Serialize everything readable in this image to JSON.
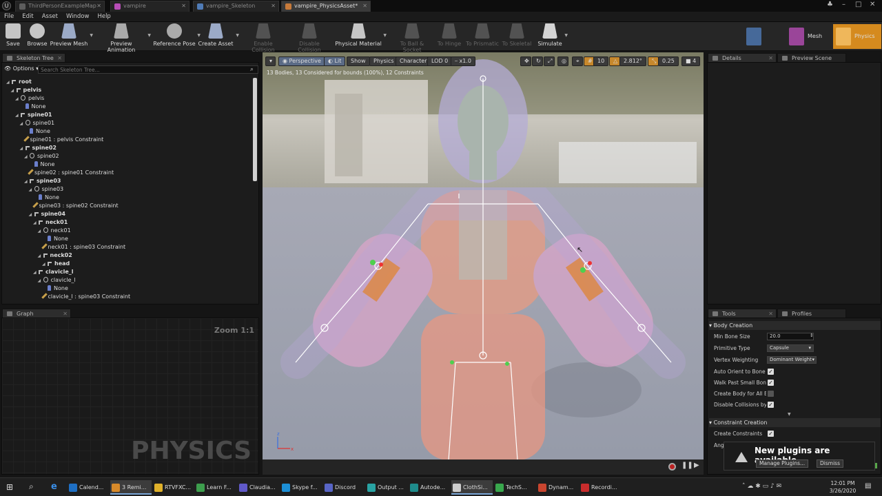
{
  "tabs": [
    {
      "label": "ThirdPersonExampleMap",
      "active": false,
      "color": "#5d5d5d"
    },
    {
      "label": "vampire",
      "active": false,
      "color": "#b84db7"
    },
    {
      "label": "vampire_Skeleton",
      "active": false,
      "color": "#4f7bb6"
    },
    {
      "label": "vampire_PhysicsAsset*",
      "active": true,
      "color": "#c77a3a"
    }
  ],
  "menu": [
    "File",
    "Edit",
    "Asset",
    "Window",
    "Help"
  ],
  "toolbar": [
    {
      "label": "Save",
      "icon": "save-icon",
      "enabled": true
    },
    {
      "label": "Browse",
      "icon": "browse-icon",
      "enabled": true
    },
    {
      "label": "Preview Mesh",
      "icon": "preview-mesh-icon",
      "enabled": true
    },
    {
      "label": "Preview Animation",
      "icon": "preview-animation-icon",
      "enabled": true
    },
    {
      "label": "Reference Pose",
      "icon": "reference-pose-icon",
      "enabled": true
    },
    {
      "label": "Create Asset",
      "icon": "create-asset-icon",
      "enabled": true
    },
    {
      "label": "Enable Collision",
      "icon": "enable-collision-icon",
      "enabled": false
    },
    {
      "label": "Disable Collision",
      "icon": "disable-collision-icon",
      "enabled": false
    },
    {
      "label": "Physical Material",
      "icon": "physical-material-icon",
      "enabled": true
    },
    {
      "label": "To Ball & Socket",
      "icon": "ball-socket-icon",
      "enabled": false
    },
    {
      "label": "To Hinge",
      "icon": "hinge-icon",
      "enabled": false
    },
    {
      "label": "To Prismatic",
      "icon": "prismatic-icon",
      "enabled": false
    },
    {
      "label": "To Skeletal",
      "icon": "skeletal-icon",
      "enabled": false
    },
    {
      "label": "Simulate",
      "icon": "simulate-icon",
      "enabled": true
    }
  ],
  "modes": [
    {
      "label": "Skeleton",
      "active": false
    },
    {
      "label": "Mesh",
      "active": false
    },
    {
      "label": "Physics",
      "active": true
    }
  ],
  "skeleton_tree": {
    "tab": "Skeleton Tree",
    "options": "Options",
    "search_placeholder": "Search Skeleton Tree...",
    "rows": [
      {
        "text": "root",
        "kind": "bone",
        "depth": 0,
        "bold": true
      },
      {
        "text": "pelvis",
        "kind": "bone",
        "depth": 1,
        "bold": true
      },
      {
        "text": "pelvis",
        "kind": "body",
        "depth": 2,
        "bold": false
      },
      {
        "text": "None",
        "kind": "shape",
        "depth": 3,
        "bold": false
      },
      {
        "text": "spine01",
        "kind": "bone",
        "depth": 2,
        "bold": true
      },
      {
        "text": "spine01",
        "kind": "body",
        "depth": 3,
        "bold": false
      },
      {
        "text": "None",
        "kind": "shape",
        "depth": 4,
        "bold": false
      },
      {
        "text": "spine01 : pelvis Constraint",
        "kind": "constr",
        "depth": 3,
        "bold": false
      },
      {
        "text": "spine02",
        "kind": "bone",
        "depth": 3,
        "bold": true
      },
      {
        "text": "spine02",
        "kind": "body",
        "depth": 4,
        "bold": false
      },
      {
        "text": "None",
        "kind": "shape",
        "depth": 5,
        "bold": false
      },
      {
        "text": "spine02 : spine01 Constraint",
        "kind": "constr",
        "depth": 4,
        "bold": false
      },
      {
        "text": "spine03",
        "kind": "bone",
        "depth": 4,
        "bold": true
      },
      {
        "text": "spine03",
        "kind": "body",
        "depth": 5,
        "bold": false
      },
      {
        "text": "None",
        "kind": "shape",
        "depth": 6,
        "bold": false
      },
      {
        "text": "spine03 : spine02 Constraint",
        "kind": "constr",
        "depth": 5,
        "bold": false
      },
      {
        "text": "spine04",
        "kind": "bone",
        "depth": 5,
        "bold": true
      },
      {
        "text": "neck01",
        "kind": "bone",
        "depth": 6,
        "bold": true
      },
      {
        "text": "neck01",
        "kind": "body",
        "depth": 7,
        "bold": false
      },
      {
        "text": "None",
        "kind": "shape",
        "depth": 8,
        "bold": false
      },
      {
        "text": "neck01 : spine03 Constraint",
        "kind": "constr",
        "depth": 7,
        "bold": false
      },
      {
        "text": "neck02",
        "kind": "bone",
        "depth": 7,
        "bold": true
      },
      {
        "text": "head",
        "kind": "bone",
        "depth": 8,
        "bold": true
      },
      {
        "text": "clavicle_l",
        "kind": "bone",
        "depth": 6,
        "bold": true
      },
      {
        "text": "clavicle_l",
        "kind": "body",
        "depth": 7,
        "bold": false
      },
      {
        "text": "None",
        "kind": "shape",
        "depth": 8,
        "bold": false
      },
      {
        "text": "clavicle_l : spine03 Constraint",
        "kind": "constr",
        "depth": 7,
        "bold": false
      }
    ]
  },
  "graph": {
    "tab": "Graph",
    "zoom": "Zoom 1:1",
    "watermark": "PHYSICS"
  },
  "viewport": {
    "perspective": "Perspective",
    "lit": "Lit",
    "show": "Show",
    "physics": "Physics",
    "character": "Character",
    "lod": "LOD 0",
    "speed": "x1.0",
    "grid": "10",
    "angle": "2.812°",
    "scale": "0.25",
    "cam": "4",
    "info": "13 Bodies, 13 Considered for bounds (100%), 12 Constraints"
  },
  "details": {
    "tab1": "Details",
    "tab2": "Preview Scene Sett"
  },
  "tools": {
    "tab1": "Tools",
    "tab2": "Profiles",
    "body_creation": "Body Creation",
    "min_bone_size_label": "Min Bone Size",
    "min_bone_size": "20.0",
    "primitive_type_label": "Primitive Type",
    "primitive_type": "Capsule",
    "vertex_weighting_label": "Vertex Weighting Type",
    "vertex_weighting": "Dominant Weight",
    "auto_orient_label": "Auto Orient to Bone",
    "auto_orient": true,
    "walk_past_label": "Walk Past Small Bones",
    "walk_past": true,
    "create_body_label": "Create Body for All Bones",
    "create_body": false,
    "disable_collisions_label": "Disable Collisions by Default",
    "disable_collisions": true,
    "constraint_creation": "Constraint Creation",
    "create_constraints_label": "Create Constraints",
    "create_constraints": true,
    "angular_label": "Ang"
  },
  "notification": {
    "title": "New plugins are available",
    "manage": "Manage Plugins...",
    "dismiss": "Dismiss"
  },
  "taskbar": {
    "items": [
      {
        "label": "Calend...",
        "color": "#1e6fc4",
        "active": false
      },
      {
        "label": "3 Remi...",
        "color": "#d88a2a",
        "active": true
      },
      {
        "label": "RTVFXC...",
        "color": "#e0b12a",
        "active": false
      },
      {
        "label": "Learn F...",
        "color": "#3d9e4d",
        "active": false
      },
      {
        "label": "Claudia...",
        "color": "#6059c9",
        "active": false
      },
      {
        "label": "Skype f...",
        "color": "#1c8fd6",
        "active": false
      },
      {
        "label": "Discord",
        "color": "#5865c6",
        "active": false
      },
      {
        "label": "Output ...",
        "color": "#29a3a3",
        "active": false
      },
      {
        "label": "Autode...",
        "color": "#1f8c8c",
        "active": false
      },
      {
        "label": "ClothSi...",
        "color": "#cfcfcf",
        "active": true
      },
      {
        "label": "TechS...",
        "color": "#39a84d",
        "active": false
      },
      {
        "label": "Dynam...",
        "color": "#c9452f",
        "active": false
      },
      {
        "label": "Recordi...",
        "color": "#c82c2c",
        "active": false
      }
    ],
    "time": "12:01 PM",
    "date": "3/26/2020"
  }
}
